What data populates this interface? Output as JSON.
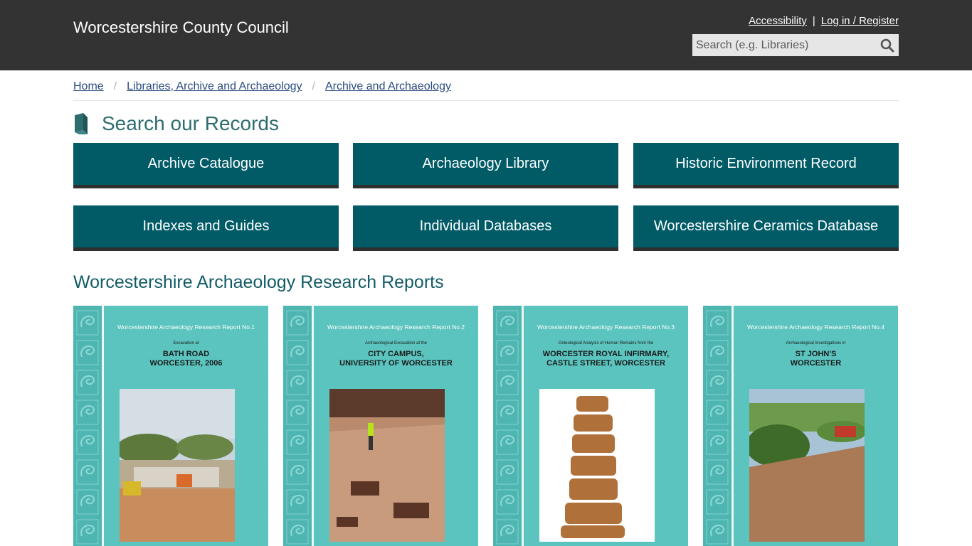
{
  "header": {
    "site_title": "Worcestershire County Council",
    "accessibility": "Accessibility",
    "separator": "|",
    "login": "Log in / Register",
    "search_placeholder": "Search (e.g. Libraries)",
    "search_icon": "search-icon"
  },
  "breadcrumb": [
    {
      "label": "Home"
    },
    {
      "label": "Libraries, Archive and Archaeology"
    },
    {
      "label": "Archive and Archaeology"
    }
  ],
  "breadcrumb_sep": "/",
  "records": {
    "title": "Search our Records",
    "icon": "book-icon",
    "buttons": [
      "Archive Catalogue",
      "Archaeology Library",
      "Historic Environment Record",
      "Indexes and Guides",
      "Individual Databases",
      "Worcestershire Ceramics Database"
    ]
  },
  "reports": {
    "title": "Worcestershire Archaeology Research Reports",
    "covers": [
      {
        "series": "Worcestershire Archaeology Research Report No.1",
        "sub": "Excavation at",
        "title_line1": "BATH ROAD",
        "title_line2": "WORCESTER, 2006"
      },
      {
        "series": "Worcestershire Archaeology Research Report No.2",
        "sub": "Archaeological Excavation at the",
        "title_line1": "CITY CAMPUS,",
        "title_line2": "UNIVERSITY OF WORCESTER"
      },
      {
        "series": "Worcestershire Archaeology Research Report No.3",
        "sub": "Osteological Analysis of Human Remains from the",
        "title_line1": "WORCESTER ROYAL INFIRMARY,",
        "title_line2": "CASTLE STREET, WORCESTER"
      },
      {
        "series": "Worcestershire Archaeology Research Report No.4",
        "sub": "Archaeological Investigations in",
        "title_line1": "ST JOHN'S",
        "title_line2": "WORCESTER"
      }
    ]
  },
  "colors": {
    "header_bg": "#333333",
    "button_bg": "#005b67",
    "heading": "#2e6d6f",
    "cover_bg": "#5bc4bf"
  }
}
